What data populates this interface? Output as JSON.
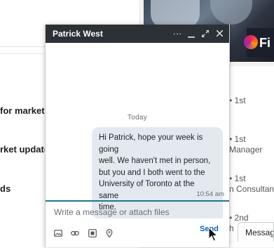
{
  "background": {
    "left_texts": [
      "for markets",
      "rket update",
      "ds"
    ],
    "connections": [
      {
        "degree": "• 1st",
        "subtitle": ""
      },
      {
        "degree": "• 1st",
        "subtitle": "Manager"
      },
      {
        "degree": "• 1st",
        "subtitle": "n Consultant"
      },
      {
        "degree": "• 2nd",
        "subtitle": "h"
      }
    ],
    "logo_text": "Fi",
    "messaging_tab_label": "Messagi"
  },
  "chat": {
    "title": "Patrick West",
    "header_buttons": {
      "more": "···",
      "minimize": "—",
      "expand": "⤢",
      "close": "✕"
    },
    "date_separator": "Today",
    "message": {
      "lines": [
        "Hi Patrick, hope your week is going",
        "well. We haven't met in person,",
        "but you and I both went to the",
        "University of Toronto at the same",
        "time."
      ],
      "time": "10:54 am"
    },
    "compose_placeholder": "Write a message or attach files",
    "toolbar_icons": [
      "image-icon",
      "link-icon",
      "gif-icon",
      "location-icon"
    ],
    "send_label": "Send"
  }
}
